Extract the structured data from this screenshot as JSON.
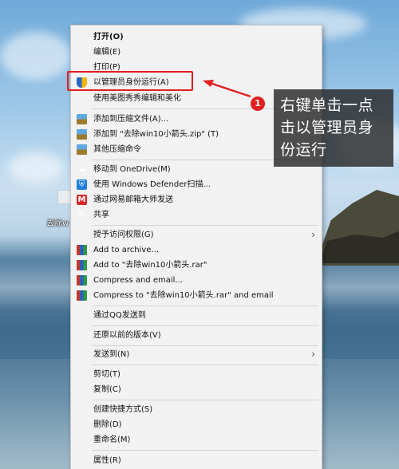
{
  "desktop": {
    "icon_label": "去除w 箭头"
  },
  "menu": {
    "items": [
      {
        "label": "打开(O)",
        "bold": true
      },
      {
        "label": "编辑(E)"
      },
      {
        "label": "打印(P)"
      },
      {
        "label": "以管理员身份运行(A)",
        "icon": "shield-icon"
      },
      {
        "label": "使用美图秀秀编辑和美化"
      },
      {
        "label": "添加到压缩文件(A)...",
        "icon": "archive-icon"
      },
      {
        "label": "添加到 \"去除win10小箭头.zip\" (T)",
        "icon": "archive-icon"
      },
      {
        "label": "其他压缩命令",
        "icon": "archive-icon"
      },
      {
        "label": "移动到 OneDrive(M)",
        "icon": "onedrive-icon"
      },
      {
        "label": "使用 Windows Defender扫描...",
        "icon": "defender-icon"
      },
      {
        "label": "通过网易邮箱大师发送",
        "icon": "mail-icon"
      },
      {
        "label": "共享",
        "icon": "share-icon"
      },
      {
        "label": "授予访问权限(G)",
        "submenu": true
      },
      {
        "label": "Add to archive...",
        "icon": "winrar-icon"
      },
      {
        "label": "Add to \"去除win10小箭头.rar\"",
        "icon": "winrar-icon"
      },
      {
        "label": "Compress and email...",
        "icon": "winrar-icon"
      },
      {
        "label": "Compress to \"去除win10小箭头.rar\" and email",
        "icon": "winrar-icon"
      },
      {
        "label": "通过QQ发送到"
      },
      {
        "label": "还原以前的版本(V)"
      },
      {
        "label": "发送到(N)",
        "submenu": true
      },
      {
        "label": "剪切(T)"
      },
      {
        "label": "复制(C)"
      },
      {
        "label": "创建快捷方式(S)"
      },
      {
        "label": "删除(D)"
      },
      {
        "label": "重命名(M)"
      },
      {
        "label": "属性(R)"
      }
    ],
    "submenu_arrow": "›"
  },
  "annotation": {
    "step_number": "1",
    "callout_text": "右键单击一点击以管理员身份运行",
    "highlight_color": "#e02020"
  }
}
